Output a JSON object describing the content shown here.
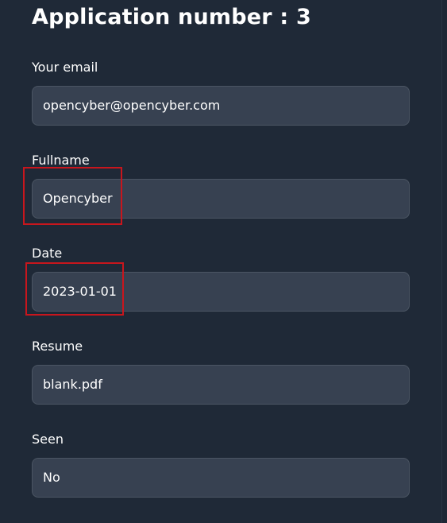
{
  "title": "Application number : 3",
  "fields": [
    {
      "label": "Your email",
      "value": "opencyber@opencyber.com"
    },
    {
      "label": "Fullname",
      "value": "Opencyber"
    },
    {
      "label": "Date",
      "value": "2023-01-01"
    },
    {
      "label": "Resume",
      "value": "blank.pdf"
    },
    {
      "label": "Seen",
      "value": "No"
    }
  ],
  "colors": {
    "background": "#1f2937",
    "input_background": "#374151",
    "input_border": "#4b5563",
    "highlight": "#c8161d"
  }
}
